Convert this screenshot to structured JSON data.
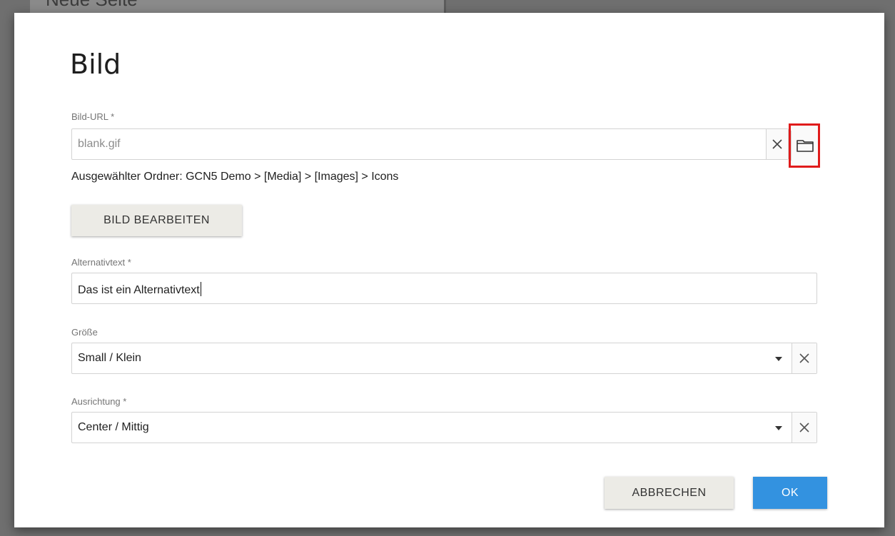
{
  "background": {
    "page_title": "Neue Seite"
  },
  "dialog": {
    "title": "Bild",
    "image_url": {
      "label": "Bild-URL *",
      "value": "blank.gif",
      "clear_icon": "close-icon",
      "browse_icon": "folder-icon",
      "highlight_color": "#e01b1b"
    },
    "selected_folder": "Ausgewählter Ordner: GCN5 Demo > [Media] > [Images] > Icons",
    "edit_button_label": "BILD BEARBEITEN",
    "alt_text": {
      "label": "Alternativtext *",
      "value": "Das ist ein Alternativtext"
    },
    "size": {
      "label": "Größe",
      "selected": "Small / Klein"
    },
    "alignment": {
      "label": "Ausrichtung *",
      "selected": "Center / Mittig"
    },
    "buttons": {
      "cancel_label": "ABBRECHEN",
      "ok_label": "OK"
    },
    "colors": {
      "ok_button": "#3392e0",
      "secondary_button": "#ecebe6"
    }
  }
}
